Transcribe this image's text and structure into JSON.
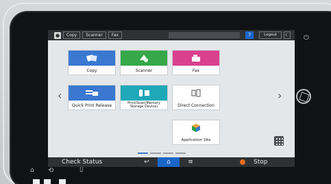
{
  "topbar": {
    "tabs": [
      "Copy",
      "Scanner",
      "Fax"
    ],
    "help_label": "?",
    "logout_label": "Logout"
  },
  "tiles": [
    {
      "label": "Copy",
      "color": "#3a78d1",
      "icon": "copy-icon"
    },
    {
      "label": "Scanner",
      "color": "#36a84a",
      "icon": "scanner-icon"
    },
    {
      "label": "Fax",
      "color": "#d9418f",
      "icon": "fax-icon"
    },
    {
      "label": "Quick Print Release",
      "color": "#3a78d1",
      "icon": "print-release-icon"
    },
    {
      "label": "Print/Scan(Memory Storage Device)",
      "color": "#1fa8b8",
      "icon": "memory-storage-icon"
    },
    {
      "label": "Direct Connection",
      "color": "#ffffff",
      "icon": "direct-connection-icon"
    },
    {
      "label": "Application Site",
      "color": "#ffffff",
      "icon": "application-site-icon"
    }
  ],
  "bottombar": {
    "check_status": "Check Status",
    "stop": "Stop"
  }
}
